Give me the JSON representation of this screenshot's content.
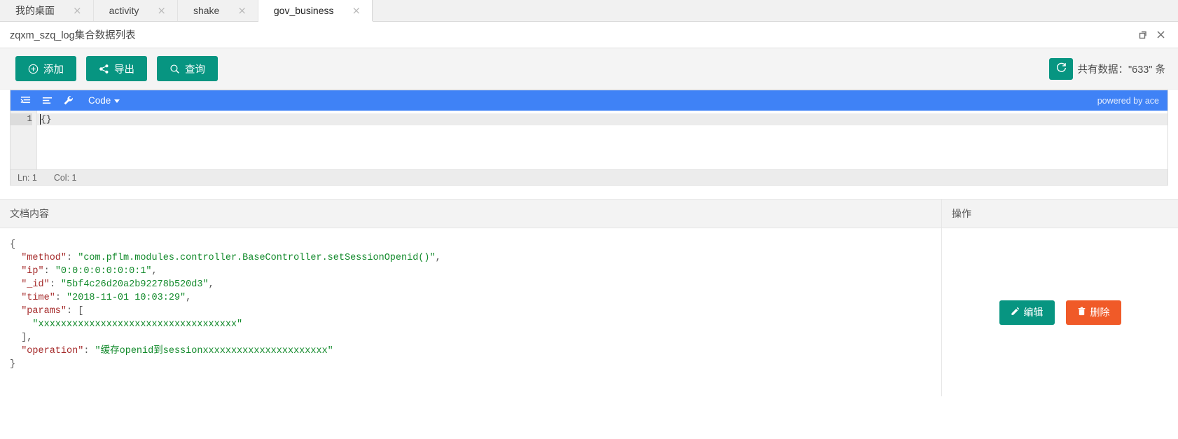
{
  "tabs": [
    {
      "label": "我的桌面",
      "close": "×",
      "active": false
    },
    {
      "label": "activity",
      "close": "×",
      "active": false
    },
    {
      "label": "shake",
      "close": "×",
      "active": false
    },
    {
      "label": "gov_business",
      "close": "×",
      "active": true
    }
  ],
  "titlebar": {
    "title": "zqxm_szq_log集合数据列表",
    "restore_icon": "restore-window-icon",
    "close_icon": "close-window-icon"
  },
  "toolbar": {
    "add_label": "添加",
    "export_label": "导出",
    "query_label": "查询",
    "add_icon": "plus-circle-icon",
    "export_icon": "share-icon",
    "query_icon": "search-icon",
    "refresh_icon": "refresh-icon",
    "count_text": "共有数据：\"633\" 条",
    "accent_color": "#079581"
  },
  "editor": {
    "menu": {
      "indent_icon": "format-indent-icon",
      "compact_icon": "format-compact-icon",
      "wrench_icon": "wrench-icon",
      "mode_label": "Code",
      "powered_by": "powered by ace"
    },
    "gutter": [
      "1"
    ],
    "content": "{}",
    "status": {
      "line": "Ln: 1",
      "column": "Col: 1"
    },
    "toolbar_color": "#3f82f6"
  },
  "table": {
    "headers": {
      "document": "文档内容",
      "operation": "操作"
    },
    "rows": [
      {
        "json_lines": [
          {
            "indent": 0,
            "parts": [
              {
                "t": "punc",
                "v": "{"
              }
            ]
          },
          {
            "indent": 1,
            "parts": [
              {
                "t": "key",
                "v": "\"method\""
              },
              {
                "t": "punc",
                "v": ": "
              },
              {
                "t": "str",
                "v": "\"com.pflm.modules.controller.BaseController.setSessionOpenid()\""
              },
              {
                "t": "punc",
                "v": ","
              }
            ]
          },
          {
            "indent": 1,
            "parts": [
              {
                "t": "key",
                "v": "\"ip\""
              },
              {
                "t": "punc",
                "v": ": "
              },
              {
                "t": "str",
                "v": "\"0:0:0:0:0:0:0:1\""
              },
              {
                "t": "punc",
                "v": ","
              }
            ]
          },
          {
            "indent": 1,
            "parts": [
              {
                "t": "key",
                "v": "\"_id\""
              },
              {
                "t": "punc",
                "v": ": "
              },
              {
                "t": "str",
                "v": "\"5bf4c26d20a2b92278b520d3\""
              },
              {
                "t": "punc",
                "v": ","
              }
            ]
          },
          {
            "indent": 1,
            "parts": [
              {
                "t": "key",
                "v": "\"time\""
              },
              {
                "t": "punc",
                "v": ": "
              },
              {
                "t": "str",
                "v": "\"2018-11-01 10:03:29\""
              },
              {
                "t": "punc",
                "v": ","
              }
            ]
          },
          {
            "indent": 1,
            "parts": [
              {
                "t": "key",
                "v": "\"params\""
              },
              {
                "t": "punc",
                "v": ": ["
              }
            ]
          },
          {
            "indent": 2,
            "parts": [
              {
                "t": "str",
                "v": "\"xxxxxxxxxxxxxxxxxxxxxxxxxxxxxxxxxxx\""
              }
            ]
          },
          {
            "indent": 1,
            "parts": [
              {
                "t": "punc",
                "v": "],"
              }
            ]
          },
          {
            "indent": 1,
            "parts": [
              {
                "t": "key",
                "v": "\"operation\""
              },
              {
                "t": "punc",
                "v": ": "
              },
              {
                "t": "str",
                "v": "\"缓存openid到sessionxxxxxxxxxxxxxxxxxxxxxx\""
              }
            ]
          },
          {
            "indent": 0,
            "parts": [
              {
                "t": "punc",
                "v": "}"
              }
            ]
          }
        ],
        "edit_label": "编辑",
        "delete_label": "删除",
        "edit_icon": "pencil-icon",
        "delete_icon": "trash-icon"
      }
    ]
  }
}
